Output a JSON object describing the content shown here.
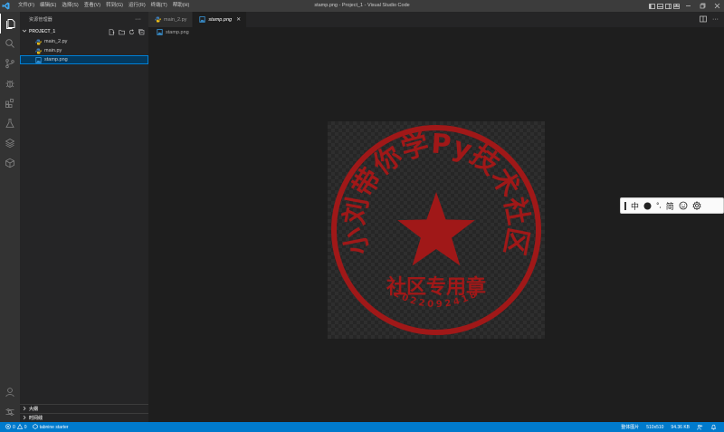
{
  "window": {
    "title": "stamp.png - Project_1 - Visual Studio Code",
    "menu": [
      "文件(F)",
      "编辑(E)",
      "选择(S)",
      "查看(V)",
      "转到(G)",
      "运行(R)",
      "终端(T)",
      "帮助(H)"
    ]
  },
  "sidebar": {
    "title": "资源管理器",
    "more": "···",
    "project": "PROJECT_1",
    "files": [
      {
        "name": "main_2.py",
        "icon": "python-file-icon"
      },
      {
        "name": "main.py",
        "icon": "python-file-icon"
      },
      {
        "name": "stamp.png",
        "icon": "image-file-icon",
        "selected": true
      }
    ],
    "outline": "大纲",
    "timeline": "时间线"
  },
  "editor": {
    "tabs": [
      {
        "label": "main_2.py",
        "active": false
      },
      {
        "label": "stamp.png",
        "active": true,
        "close": "✕"
      }
    ],
    "breadcrumb": "stamp.png",
    "stamp": {
      "arc_text": "小刘带你学Py技术社区",
      "center_text": "社区专用章",
      "number": "2022092418",
      "color": "#a01818"
    }
  },
  "ime": {
    "mode": "中",
    "punct": "°,",
    "charset": "简"
  },
  "statusbar": {
    "errors": "0",
    "warnings": "0",
    "tabnine": "tabnine starter",
    "image_mode": "整体图片",
    "dimensions": "510x510",
    "size": "94.36 KB"
  },
  "colors": {
    "statusbar": "#007acc",
    "selection": "#04395e",
    "stamp": "#a01818"
  }
}
